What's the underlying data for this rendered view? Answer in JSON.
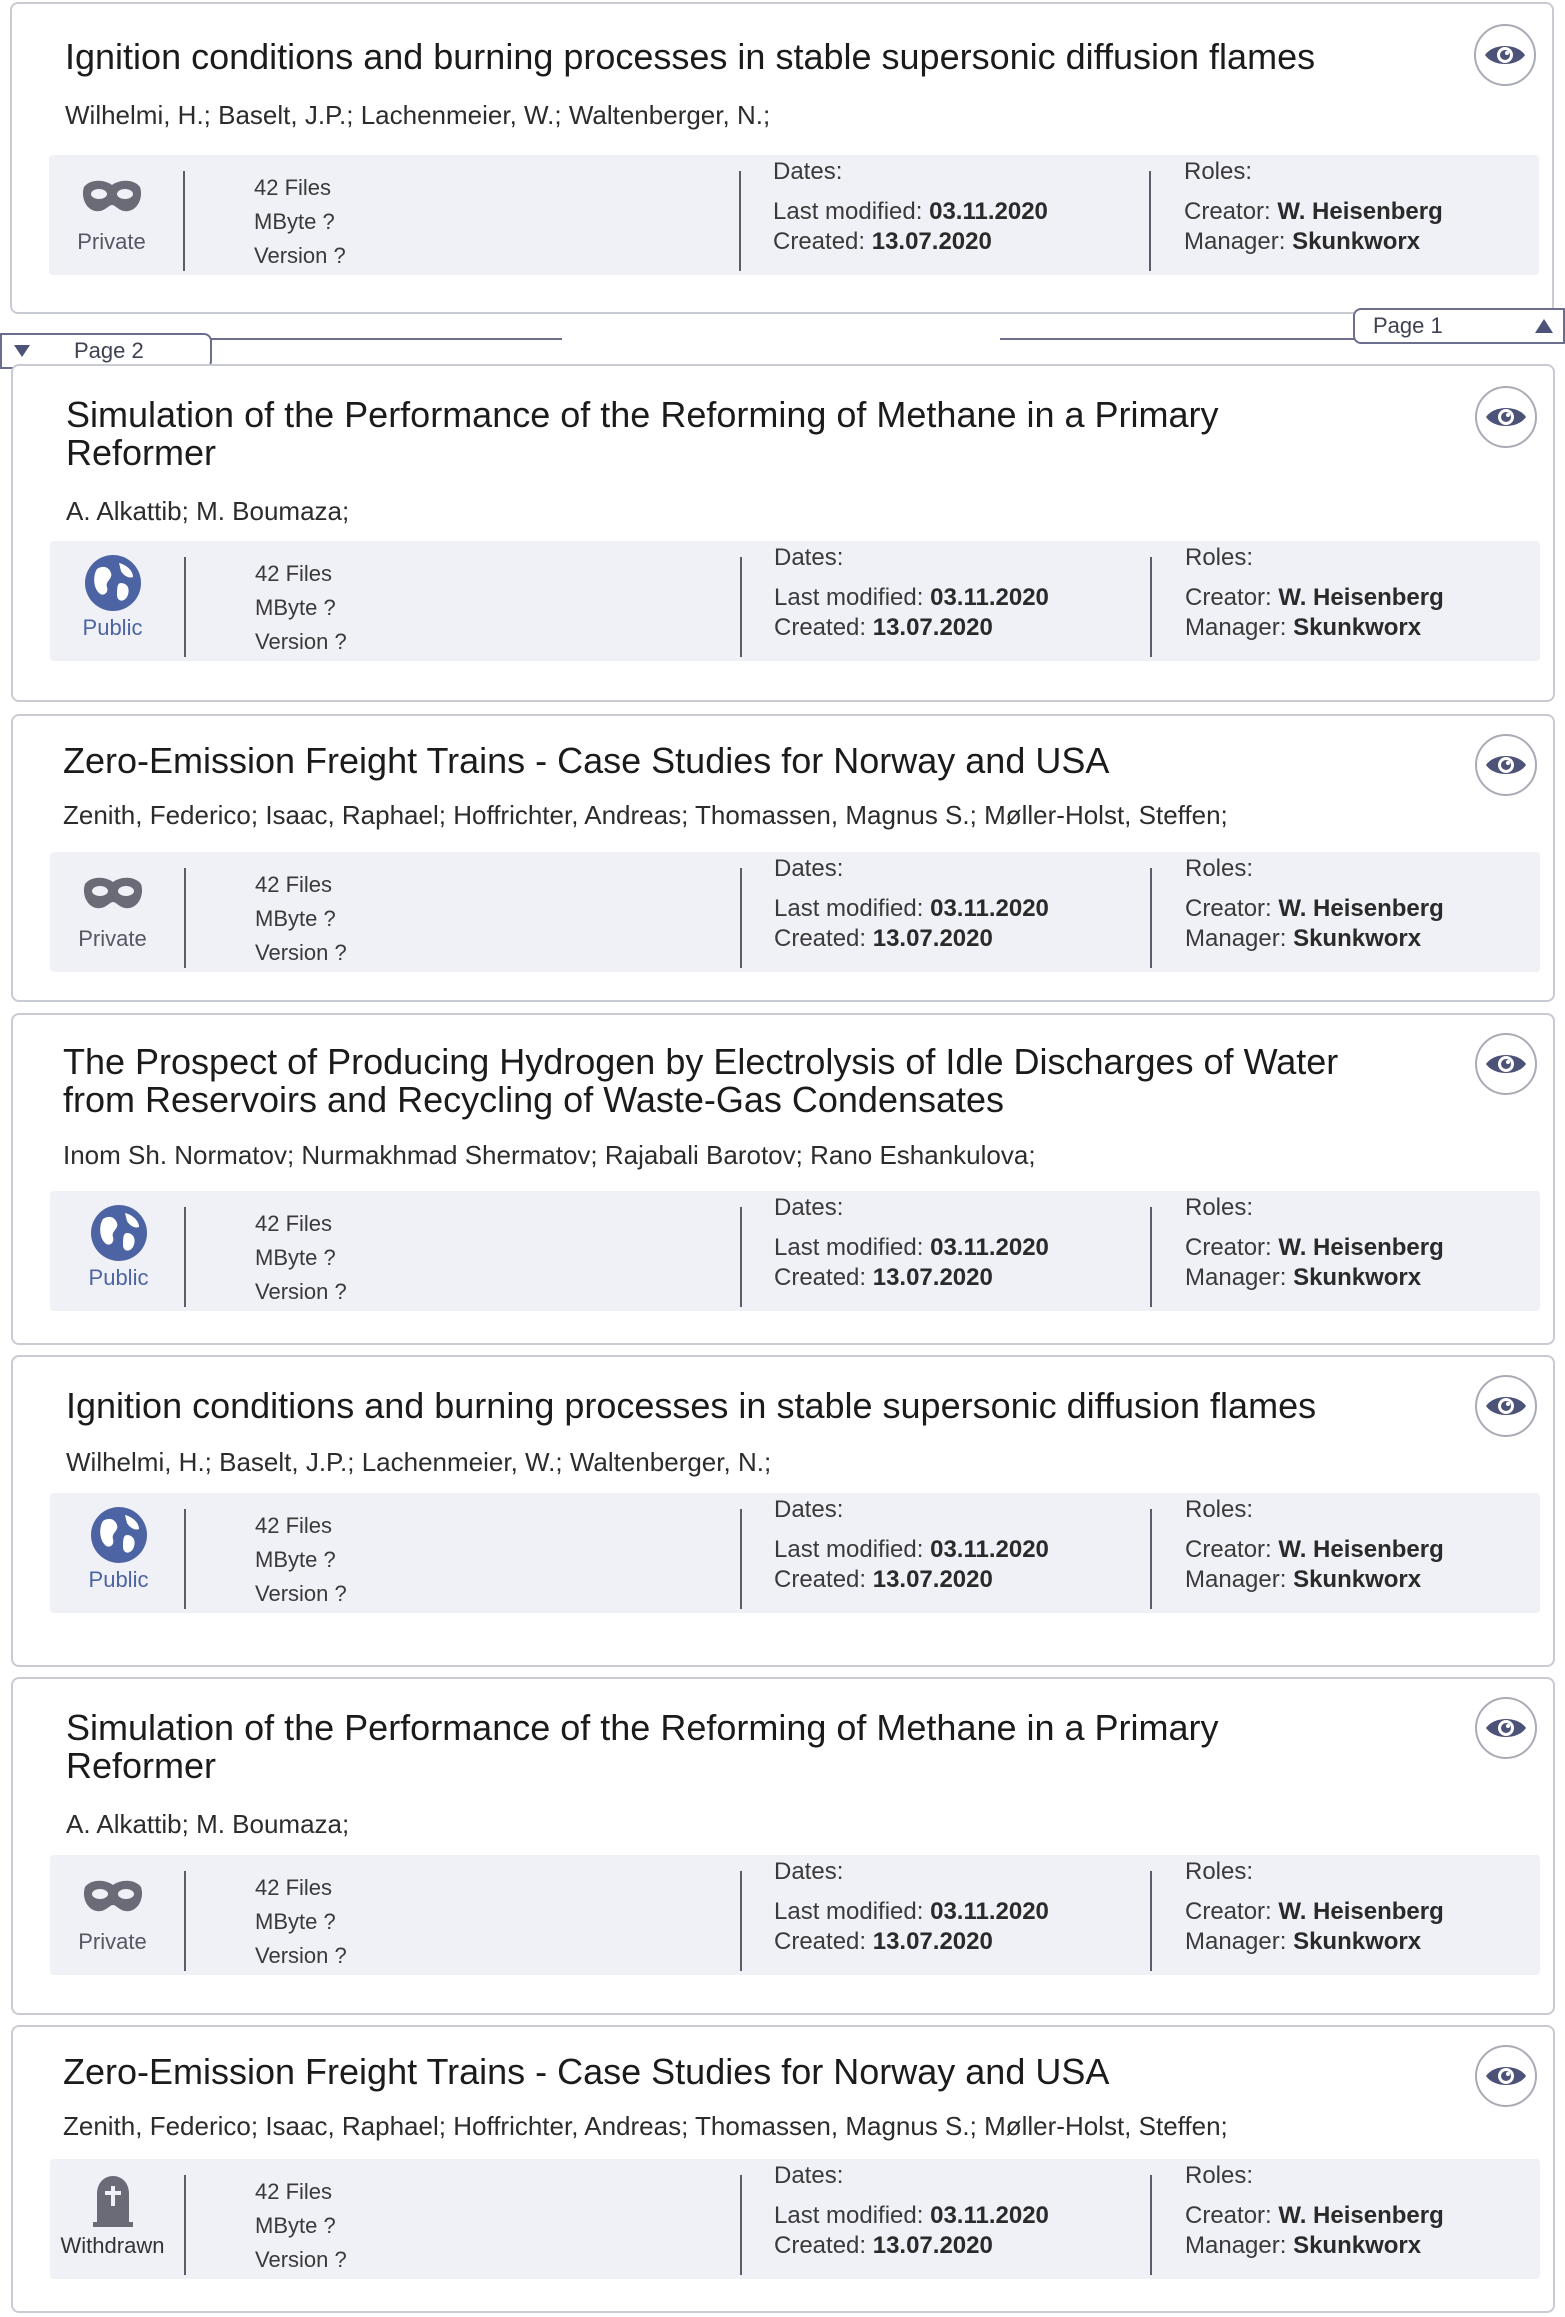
{
  "colors": {
    "public_accent": "#4c64a4",
    "private_icon": "#6b6b78",
    "eye_icon": "#4c5278",
    "divider": "#6b6e8c"
  },
  "pager": {
    "previous_label": "Page 2",
    "previous_icon": "triangle-down-icon",
    "next_label": "Page 1",
    "next_icon": "triangle-up-icon"
  },
  "cards": [
    {
      "title": "Ignition conditions and burning processes in stable supersonic diffusion flames",
      "authors": "Wilhelmi, H.; Baselt, J.P.; Lachenmeier, W.; Waltenberger, N.;",
      "visibility": "Private",
      "visibility_icon": "mask-icon",
      "files": "42 Files",
      "mbyte": "MByte ?",
      "version": "Version ?",
      "dates_label": "Dates:",
      "last_modified_label": "Last modified: ",
      "last_modified": "03.11.2020",
      "created_label": "Created: ",
      "created": "13.07.2020",
      "roles_label": "Roles:",
      "creator_label": "Creator: ",
      "creator": "W. Heisenberg",
      "manager_label": "Manager: ",
      "manager": "Skunkworx"
    },
    {
      "title": "Simulation of the Performance of the Reforming of Methane in a Primary Reformer",
      "authors": "A. Alkattib; M. Boumaza;",
      "visibility": "Public",
      "visibility_icon": "globe-icon",
      "files": "42 Files",
      "mbyte": "MByte ?",
      "version": "Version ?",
      "dates_label": "Dates:",
      "last_modified_label": "Last modified: ",
      "last_modified": "03.11.2020",
      "created_label": "Created: ",
      "created": "13.07.2020",
      "roles_label": "Roles:",
      "creator_label": "Creator: ",
      "creator": "W. Heisenberg",
      "manager_label": "Manager: ",
      "manager": "Skunkworx"
    },
    {
      "title": "Zero-Emission Freight Trains - Case Studies for Norway and USA",
      "authors": "Zenith, Federico; Isaac, Raphael; Hoffrichter, Andreas; Thomassen, Magnus S.; Møller-Holst, Steffen;",
      "visibility": "Private",
      "visibility_icon": "mask-icon",
      "files": "42 Files",
      "mbyte": "MByte ?",
      "version": "Version ?",
      "dates_label": "Dates:",
      "last_modified_label": "Last modified: ",
      "last_modified": "03.11.2020",
      "created_label": "Created: ",
      "created": "13.07.2020",
      "roles_label": "Roles:",
      "creator_label": "Creator: ",
      "creator": "W. Heisenberg",
      "manager_label": "Manager: ",
      "manager": "Skunkworx"
    },
    {
      "title": "The Prospect of Producing Hydrogen by Electrolysis of Idle Discharges of Water from Reservoirs and Recycling of Waste-Gas Condensates",
      "authors": "Inom Sh. Normatov; Nurmakhmad Shermatov; Rajabali Barotov; Rano Eshankulova;",
      "visibility": "Public",
      "visibility_icon": "globe-icon",
      "files": "42 Files",
      "mbyte": "MByte ?",
      "version": "Version ?",
      "dates_label": "Dates:",
      "last_modified_label": "Last modified: ",
      "last_modified": "03.11.2020",
      "created_label": "Created: ",
      "created": "13.07.2020",
      "roles_label": "Roles:",
      "creator_label": "Creator: ",
      "creator": "W. Heisenberg",
      "manager_label": "Manager: ",
      "manager": "Skunkworx"
    },
    {
      "title": "Ignition conditions and burning processes in stable supersonic diffusion flames",
      "authors": "Wilhelmi, H.; Baselt, J.P.; Lachenmeier, W.; Waltenberger, N.;",
      "visibility": "Public",
      "visibility_icon": "globe-icon",
      "files": "42 Files",
      "mbyte": "MByte ?",
      "version": "Version ?",
      "dates_label": "Dates:",
      "last_modified_label": "Last modified: ",
      "last_modified": "03.11.2020",
      "created_label": "Created: ",
      "created": "13.07.2020",
      "roles_label": "Roles:",
      "creator_label": "Creator: ",
      "creator": "W. Heisenberg",
      "manager_label": "Manager: ",
      "manager": "Skunkworx"
    },
    {
      "title": "Simulation of the Performance of the Reforming of Methane in a Primary Reformer",
      "authors": "A. Alkattib; M. Boumaza;",
      "visibility": "Private",
      "visibility_icon": "mask-icon",
      "files": "42 Files",
      "mbyte": "MByte ?",
      "version": "Version ?",
      "dates_label": "Dates:",
      "last_modified_label": "Last modified: ",
      "last_modified": "03.11.2020",
      "created_label": "Created: ",
      "created": "13.07.2020",
      "roles_label": "Roles:",
      "creator_label": "Creator: ",
      "creator": "W. Heisenberg",
      "manager_label": "Manager: ",
      "manager": "Skunkworx"
    },
    {
      "title": "Zero-Emission Freight Trains - Case Studies for Norway and USA",
      "authors": "Zenith, Federico; Isaac, Raphael; Hoffrichter, Andreas; Thomassen, Magnus S.; Møller-Holst, Steffen;",
      "visibility": "Withdrawn",
      "visibility_icon": "tombstone-icon",
      "files": "42 Files",
      "mbyte": "MByte ?",
      "version": "Version ?",
      "dates_label": "Dates:",
      "last_modified_label": "Last modified: ",
      "last_modified": "03.11.2020",
      "created_label": "Created: ",
      "created": "13.07.2020",
      "roles_label": "Roles:",
      "creator_label": "Creator: ",
      "creator": "W. Heisenberg",
      "manager_label": "Manager: ",
      "manager": "Skunkworx"
    }
  ]
}
